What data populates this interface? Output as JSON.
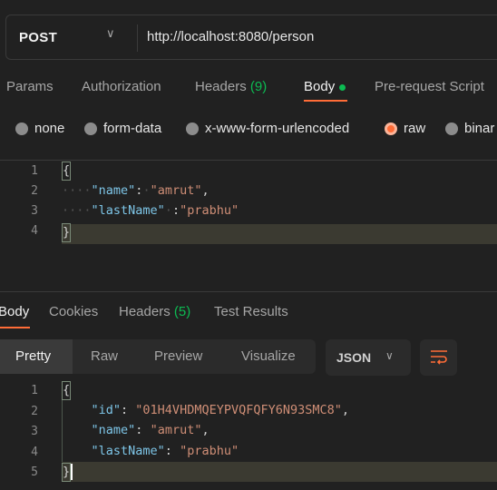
{
  "request": {
    "method": "POST",
    "url": "http://localhost:8080/person"
  },
  "req_tabs": [
    "Params",
    "Authorization",
    "Headers",
    "(9)",
    "Body",
    "Pre-request Script"
  ],
  "body_types": [
    {
      "label": "none",
      "selected": false
    },
    {
      "label": "form-data",
      "selected": false
    },
    {
      "label": "x-www-form-urlencoded",
      "selected": false
    },
    {
      "label": "raw",
      "selected": true
    },
    {
      "label": "binar",
      "selected": false
    }
  ],
  "request_body": {
    "lines": [
      "1",
      "2",
      "3",
      "4"
    ],
    "name_key": "\"name\"",
    "name_val": "\"amrut\"",
    "last_key": "\"lastName\"",
    "last_val": "\"prabhu\""
  },
  "resp_tabs": [
    "Body",
    "Cookies",
    "Headers",
    "(5)",
    "Test Results"
  ],
  "view_modes": [
    "Pretty",
    "Raw",
    "Preview",
    "Visualize"
  ],
  "format": "JSON",
  "response_body": {
    "lines": [
      "1",
      "2",
      "3",
      "4",
      "5"
    ],
    "id_key": "\"id\"",
    "id_val": "\"01H4VHDMQEYPVQFQFY6N93SMC8\"",
    "name_key": "\"name\"",
    "name_val": "\"amrut\"",
    "last_key": "\"lastName\"",
    "last_val": "\"prabhu\""
  },
  "colors": {
    "accent": "#ff6c37",
    "dot": "#0cbb52",
    "key": "#7ec6e8",
    "string": "#cf8e76"
  },
  "icons": {
    "chevron": "chevron-down-icon",
    "wrap": "wrap-lines-icon"
  }
}
